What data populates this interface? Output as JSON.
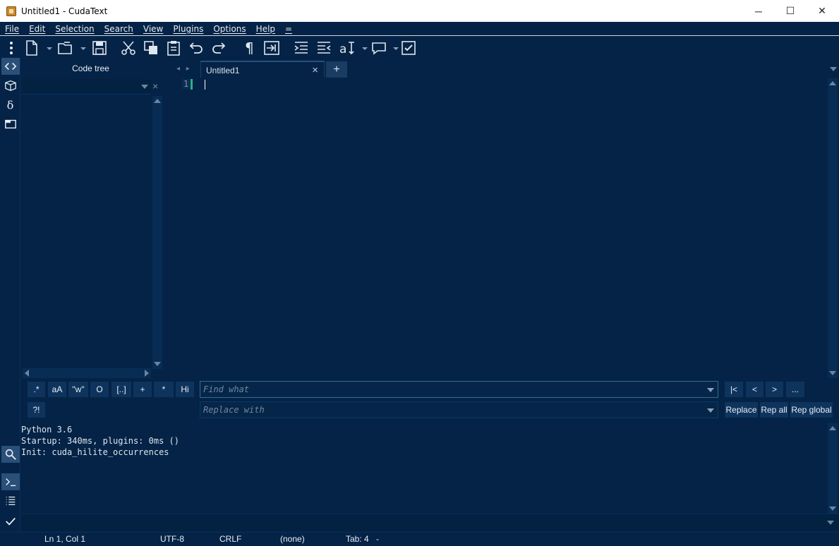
{
  "window": {
    "title": "Untitled1 - CudaText",
    "buttons": {
      "minimize": "─",
      "maximize": "☐",
      "close": "✕"
    }
  },
  "menu": [
    "File",
    "Edit",
    "Selection",
    "Search",
    "View",
    "Plugins",
    "Options",
    "Help",
    "="
  ],
  "toolbar_icons": [
    "menu-dots-icon",
    "new-file-icon",
    "open-file-icon",
    "save-icon",
    "cut-icon",
    "copy-icon",
    "paste-icon",
    "undo-icon",
    "redo-icon",
    "pilcrow-icon",
    "tab-indent-icon",
    "indent-icon",
    "unindent-icon",
    "case-icon",
    "comment-icon",
    "checkbox-icon"
  ],
  "sidebar": [
    "code-tree-icon",
    "project-icon",
    "delta-icon",
    "tabs-icon",
    "search-icon",
    "console-icon",
    "output-icon",
    "validate-icon"
  ],
  "tree": {
    "title": "Code tree",
    "close": "×"
  },
  "editor": {
    "tab_label": "Untitled1",
    "tab_close": "×",
    "tab_add": "+",
    "tab_nav": "◂ ▸",
    "line_number": "1"
  },
  "find": {
    "options": [
      ".*",
      "aA",
      "\"w\"",
      "O",
      "[..]",
      "+",
      "*",
      "Hi"
    ],
    "option2": "?!",
    "find_placeholder": "Find what",
    "replace_placeholder": "Replace with",
    "nav_buttons": [
      "|<",
      "<",
      ">",
      "..."
    ],
    "replace_buttons": [
      "Replace",
      "Rep all",
      "Rep global"
    ]
  },
  "console": {
    "lines": [
      "Python 3.6",
      "Startup: 340ms, plugins: 0ms ()",
      "Init: cuda_hilite_occurrences"
    ]
  },
  "status": {
    "position": "Ln 1, Col 1",
    "encoding": "UTF-8",
    "line_ending": "CRLF",
    "lexer": "(none)",
    "tab_size": "Tab: 4",
    "extra": "-"
  },
  "colors": {
    "background": "#042346",
    "accent": "#2a4f78",
    "gutter_mark": "#2bb07f"
  }
}
